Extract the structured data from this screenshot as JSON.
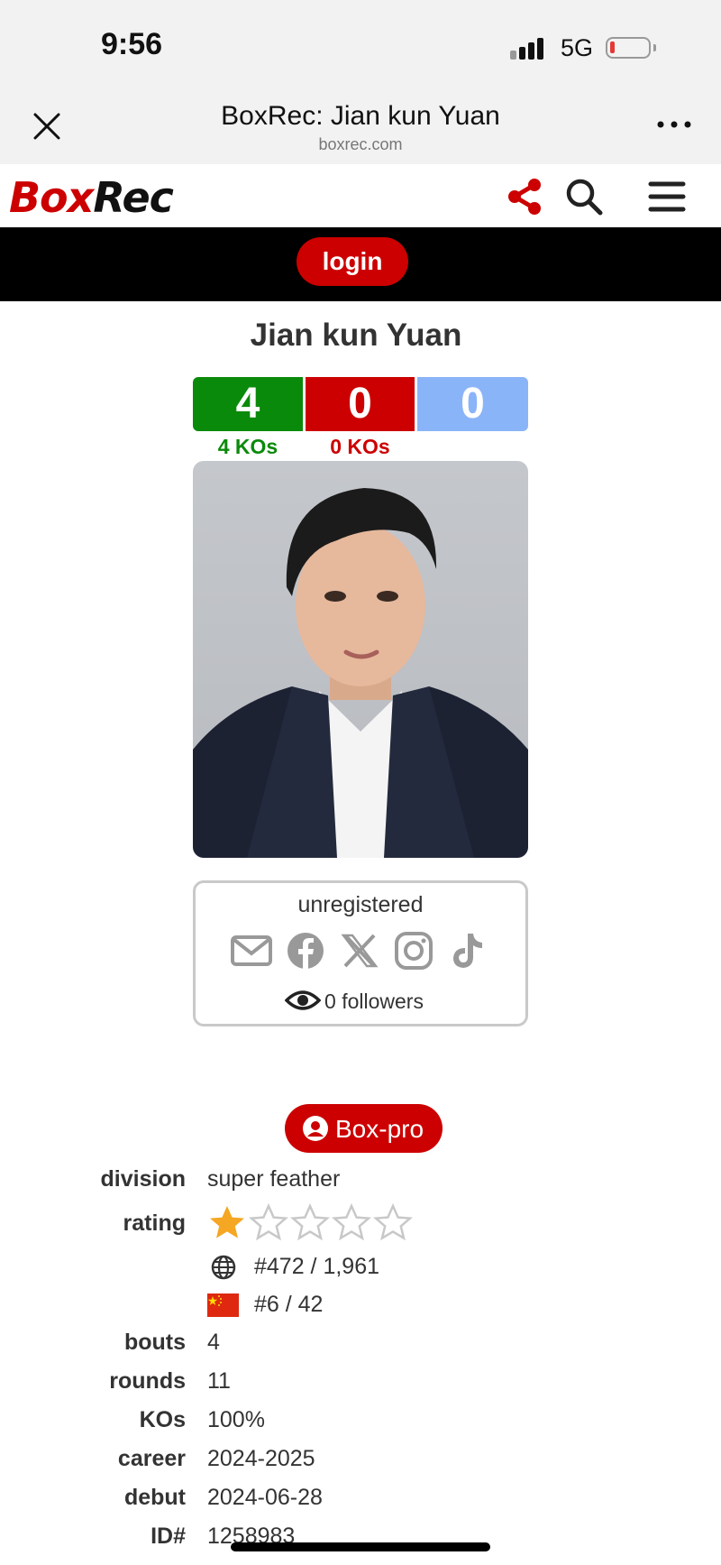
{
  "status_bar": {
    "time": "9:56",
    "network": "5G"
  },
  "browser": {
    "page_title": "BoxRec: Jian kun Yuan",
    "domain": "boxrec.com"
  },
  "site": {
    "logo_box": "Box",
    "logo_rec": "Rec",
    "login_label": "login"
  },
  "boxer": {
    "name": "Jian kun Yuan",
    "record": {
      "wins": "4",
      "losses": "0",
      "draws": "0",
      "win_kos": "4 KOs",
      "loss_kos": "0 KOs"
    },
    "account_status": "unregistered",
    "social_icons": [
      "mail-icon",
      "facebook-icon",
      "x-icon",
      "instagram-icon",
      "tiktok-icon"
    ],
    "followers": "0 followers",
    "box_pro_label": "Box-pro"
  },
  "details": {
    "division_label": "division",
    "division": "super feather",
    "rating_label": "rating",
    "rating_stars": 1,
    "rating_max": 5,
    "world_rank": "#472 / 1,961",
    "country_rank": "#6 / 42",
    "bouts_label": "bouts",
    "bouts": "4",
    "rounds_label": "rounds",
    "rounds": "11",
    "kos_label": "KOs",
    "kos": "100%",
    "career_label": "career",
    "career": "2024-2025",
    "debut_label": "debut",
    "debut": "2024-06-28",
    "id_label": "ID#",
    "id": "1258983"
  },
  "colors": {
    "brand_red": "#cc0000",
    "win_green": "#0a8a0a",
    "draw_blue": "#8ab4f8",
    "star_gold": "#f5a623"
  }
}
